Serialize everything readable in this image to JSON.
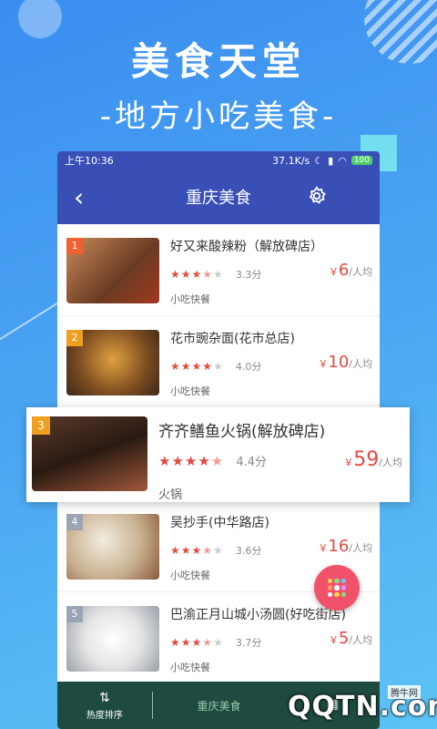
{
  "promo": {
    "headline": "美食天堂",
    "subline": "-地方小吃美食-"
  },
  "status": {
    "time": "上午10:36",
    "speed": "37.1K/s",
    "battery": "100"
  },
  "nav": {
    "title": "重庆美食"
  },
  "items": [
    {
      "rank": "1",
      "name": "好又来酸辣粉（解放碑店）",
      "stars": "★★★",
      "half": "★",
      "off": "★",
      "score": "3.3分",
      "price": "6",
      "unit": "/人均",
      "cat": "小吃快餐",
      "thumb": "#8b5a3a"
    },
    {
      "rank": "2",
      "name": "花市豌杂面(花市总店)",
      "stars": "★★★★",
      "half": "",
      "off": "★",
      "score": "4.0分",
      "price": "10",
      "unit": "/人均",
      "cat": "小吃快餐",
      "thumb": "#b07a3a"
    },
    {
      "rank": "4",
      "name": "吴抄手(中华路店)",
      "stars": "★★★",
      "half": "★",
      "off": "★",
      "score": "3.6分",
      "price": "16",
      "unit": "/人均",
      "cat": "小吃快餐",
      "thumb": "#d8c8b0"
    },
    {
      "rank": "5",
      "name": "巴渝正月山城小汤圆(好吃街店)",
      "stars": "★★★",
      "half": "★",
      "off": "★",
      "score": "3.7分",
      "price": "5",
      "unit": "/人均",
      "cat": "小吃快餐",
      "thumb": "#e8e8e8"
    }
  ],
  "popup": {
    "rank": "3",
    "name": "齐齐鳝鱼火锅(解放碑店)",
    "stars": "★★★★",
    "half": "★",
    "score": "4.4分",
    "price": "59",
    "unit": "/人均",
    "cat": "火锅"
  },
  "currency": "￥",
  "tabs": {
    "hot": "热度排序",
    "mid": "重庆美食"
  },
  "watermark": {
    "text": "QQTN.com",
    "sub": "腾牛网"
  }
}
